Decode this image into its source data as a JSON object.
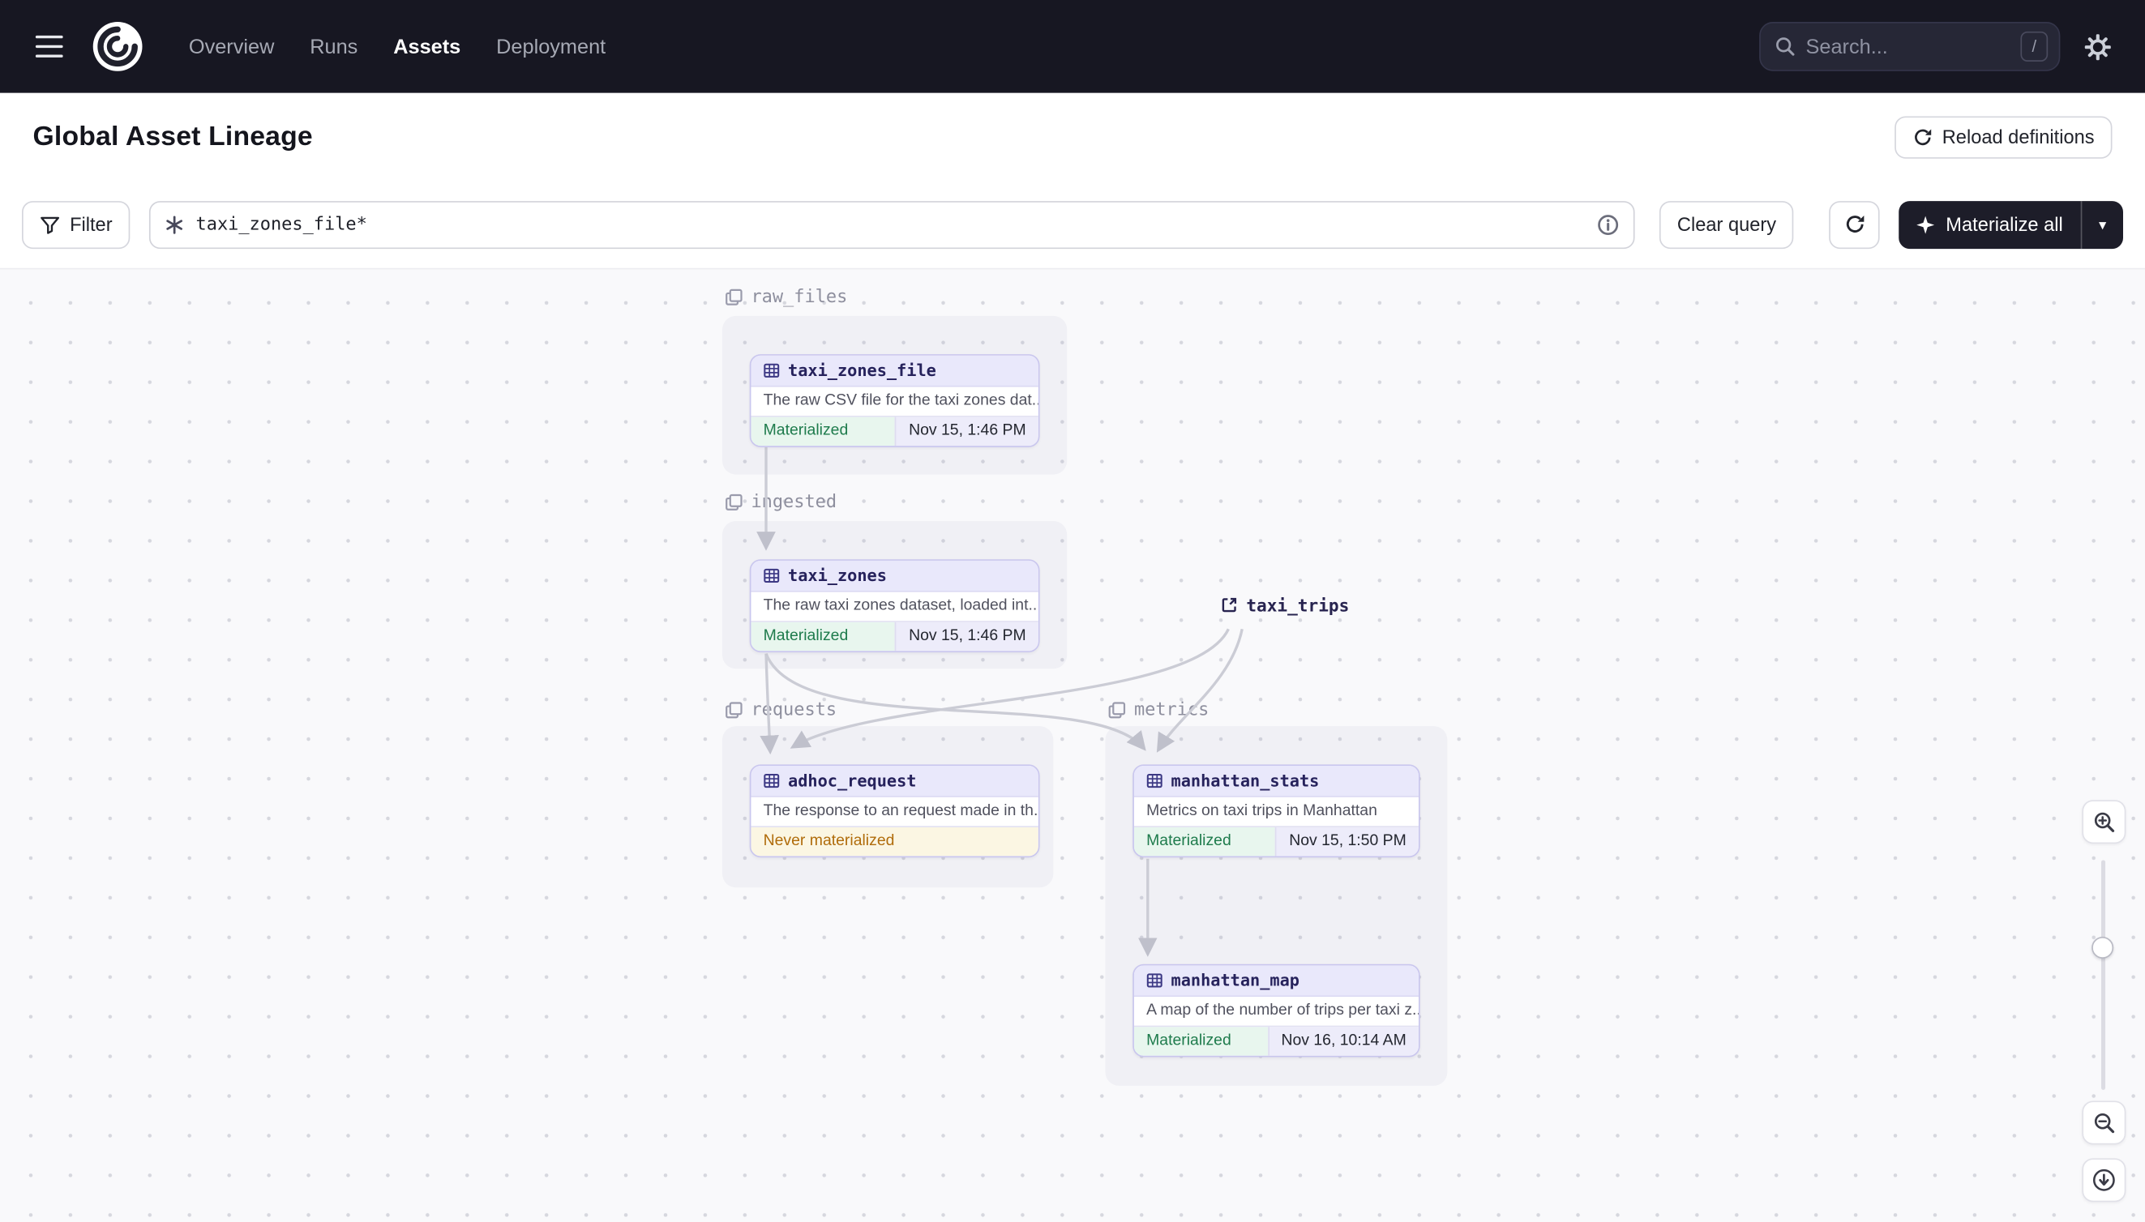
{
  "nav": {
    "items": [
      {
        "label": "Overview",
        "active": false
      },
      {
        "label": "Runs",
        "active": false
      },
      {
        "label": "Assets",
        "active": true
      },
      {
        "label": "Deployment",
        "active": false
      }
    ],
    "search": {
      "placeholder": "Search...",
      "shortcut": "/"
    }
  },
  "header": {
    "title": "Global Asset Lineage",
    "reload_button_label": "Reload definitions"
  },
  "toolbar": {
    "filter_label": "Filter",
    "query_value": "taxi_zones_file*",
    "clear_query_label": "Clear query",
    "materialize_label": "Materialize all"
  },
  "graph": {
    "groups": [
      {
        "name": "raw_files"
      },
      {
        "name": "ingested"
      },
      {
        "name": "requests"
      },
      {
        "name": "metrics"
      }
    ],
    "external_assets": [
      {
        "name": "taxi_trips"
      }
    ],
    "nodes": [
      {
        "name": "taxi_zones_file",
        "group": "raw_files",
        "description": "The raw CSV file for the taxi zones dat...",
        "status": "Materialized",
        "timestamp": "Nov 15, 1:46 PM"
      },
      {
        "name": "taxi_zones",
        "group": "ingested",
        "description": "The raw taxi zones dataset, loaded int...",
        "status": "Materialized",
        "timestamp": "Nov 15, 1:46 PM"
      },
      {
        "name": "adhoc_request",
        "group": "requests",
        "description": "The response to an request made in th...",
        "status": "Never materialized",
        "timestamp": ""
      },
      {
        "name": "manhattan_stats",
        "group": "metrics",
        "description": "Metrics on taxi trips in Manhattan",
        "status": "Materialized",
        "timestamp": "Nov 15, 1:50 PM"
      },
      {
        "name": "manhattan_map",
        "group": "metrics",
        "description": "A map of the number of trips per taxi z...",
        "status": "Materialized",
        "timestamp": "Nov 16, 10:14 AM"
      }
    ],
    "edges": [
      {
        "from": "taxi_zones_file",
        "to": "taxi_zones"
      },
      {
        "from": "taxi_zones",
        "to": "adhoc_request"
      },
      {
        "from": "taxi_zones",
        "to": "manhattan_stats"
      },
      {
        "from": "taxi_trips",
        "to": "adhoc_request"
      },
      {
        "from": "taxi_trips",
        "to": "manhattan_stats"
      },
      {
        "from": "manhattan_stats",
        "to": "manhattan_map"
      }
    ],
    "colors": {
      "materialized_text": "#1e7b4c",
      "never_materialized_text": "#b06c0b",
      "node_border": "#c9c6ee",
      "node_header_bg": "#e9e8fb",
      "accent_dark": "#1d1d29",
      "edge": "#c6c7d0"
    }
  }
}
